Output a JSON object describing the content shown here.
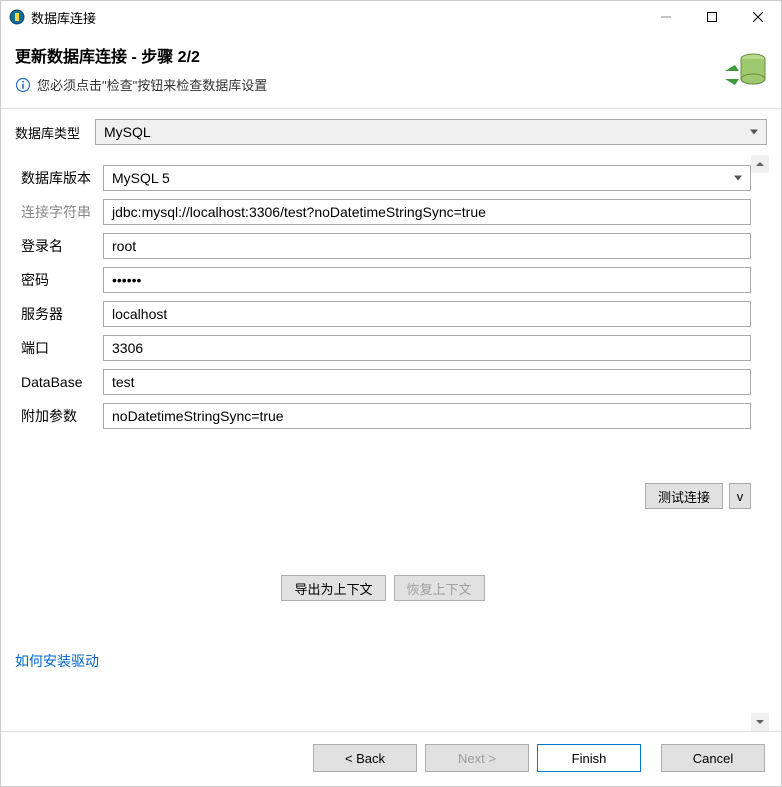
{
  "window": {
    "title": "数据库连接"
  },
  "banner": {
    "title": "更新数据库连接 - 步骤 2/2",
    "subtitle": "您必须点击\"检查\"按钮来检查数据库设置"
  },
  "dbtype": {
    "label": "数据库类型",
    "value": "MySQL"
  },
  "form": {
    "version_label": "数据库版本",
    "version_value": "MySQL 5",
    "connstr_label": "连接字符串",
    "connstr_value": "jdbc:mysql://localhost:3306/test?noDatetimeStringSync=true",
    "login_label": "登录名",
    "login_value": "root",
    "password_label": "密码",
    "password_value": "••••••",
    "server_label": "服务器",
    "server_value": "localhost",
    "port_label": "端口",
    "port_value": "3306",
    "database_label": "DataBase",
    "database_value": "test",
    "params_label": "附加参数",
    "params_value": "noDatetimeStringSync=true"
  },
  "buttons": {
    "test": "测试连接",
    "dropdown": "v",
    "export_context": "导出为上下文",
    "restore_context": "恢复上下文"
  },
  "link": {
    "install_driver": "如何安装驱动"
  },
  "wizard": {
    "back": "< Back",
    "next": "Next >",
    "finish": "Finish",
    "cancel": "Cancel"
  }
}
